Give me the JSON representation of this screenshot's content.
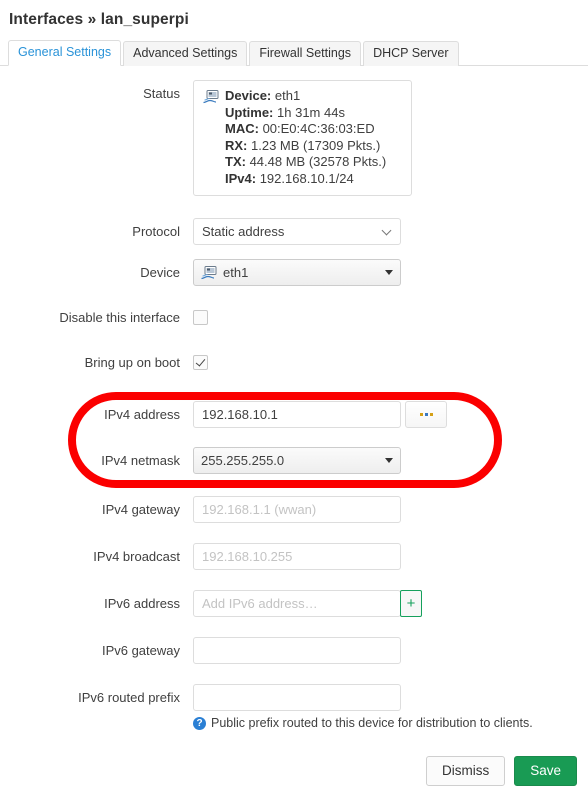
{
  "header": {
    "title": "Interfaces » lan_superpi"
  },
  "tabs": [
    {
      "label": "General Settings",
      "active": true
    },
    {
      "label": "Advanced Settings",
      "active": false
    },
    {
      "label": "Firewall Settings",
      "active": false
    },
    {
      "label": "DHCP Server",
      "active": false
    }
  ],
  "form": {
    "status": {
      "label": "Status",
      "icon": "ethernet-device-icon",
      "lines": [
        {
          "key": "Device:",
          "value": "eth1"
        },
        {
          "key": "Uptime:",
          "value": "1h 31m 44s"
        },
        {
          "key": "MAC:",
          "value": "00:E0:4C:36:03:ED"
        },
        {
          "key": "RX:",
          "value": "1.23 MB (17309 Pkts.)"
        },
        {
          "key": "TX:",
          "value": "44.48 MB (32578 Pkts.)"
        },
        {
          "key": "IPv4:",
          "value": "192.168.10.1/24"
        }
      ]
    },
    "protocol": {
      "label": "Protocol",
      "value": "Static address"
    },
    "device": {
      "label": "Device",
      "value": "eth1",
      "icon": "ethernet-device-icon"
    },
    "disable_interface": {
      "label": "Disable this interface",
      "checked": false
    },
    "bring_up_on_boot": {
      "label": "Bring up on boot",
      "checked": true
    },
    "ipv4_address": {
      "label": "IPv4 address",
      "value": "192.168.10.1",
      "placeholder": "",
      "side_button": "..."
    },
    "ipv4_netmask": {
      "label": "IPv4 netmask",
      "value": "255.255.255.0"
    },
    "ipv4_gateway": {
      "label": "IPv4 gateway",
      "value": "",
      "placeholder": "192.168.1.1 (wwan)"
    },
    "ipv4_broadcast": {
      "label": "IPv4 broadcast",
      "value": "",
      "placeholder": "192.168.10.255"
    },
    "ipv6_address": {
      "label": "IPv6 address",
      "value": "",
      "placeholder": "Add IPv6 address…",
      "add_button": "+"
    },
    "ipv6_gateway": {
      "label": "IPv6 gateway",
      "value": "",
      "placeholder": ""
    },
    "ipv6_routed_prefix": {
      "label": "IPv6 routed prefix",
      "value": "",
      "placeholder": "",
      "help": "Public prefix routed to this device for distribution to clients.",
      "help_icon": "help-question-icon"
    }
  },
  "footer": {
    "dismiss_label": "Dismiss",
    "save_label": "Save"
  },
  "annotation": {
    "type": "red-oval-highlight",
    "color": "#fb0000"
  }
}
